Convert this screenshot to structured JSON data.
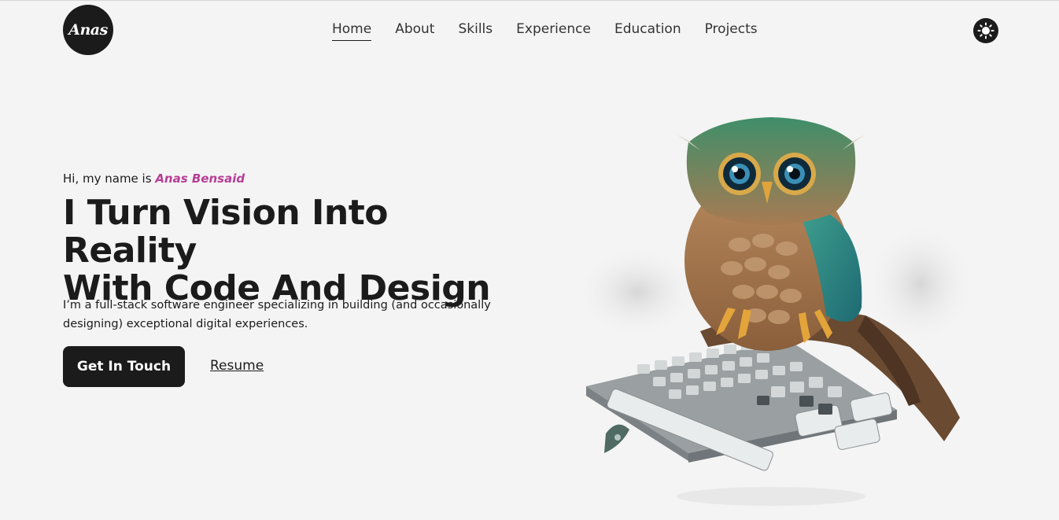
{
  "header": {
    "logo_text": "Anas",
    "nav": [
      {
        "label": "Home",
        "active": true
      },
      {
        "label": "About",
        "active": false
      },
      {
        "label": "Skills",
        "active": false
      },
      {
        "label": "Experience",
        "active": false
      },
      {
        "label": "Education",
        "active": false
      },
      {
        "label": "Projects",
        "active": false
      }
    ],
    "theme_toggle_icon": "sun-icon"
  },
  "hero": {
    "intro_prefix": "Hi, my name is ",
    "intro_name": "Anas Bensaid",
    "headline_line1": "I Turn Vision Into Reality",
    "headline_line2": "With Code And Design",
    "description": "I’m a full-stack software engineer specializing in building (and occasionally designing) exceptional digital experiences.",
    "cta_label": "Get In Touch",
    "resume_label": "Resume",
    "illustration": "owl-on-keyboard-illustration"
  },
  "colors": {
    "background": "#f4f4f4",
    "dark": "#1b1b1b",
    "accent": "#b63e96"
  }
}
